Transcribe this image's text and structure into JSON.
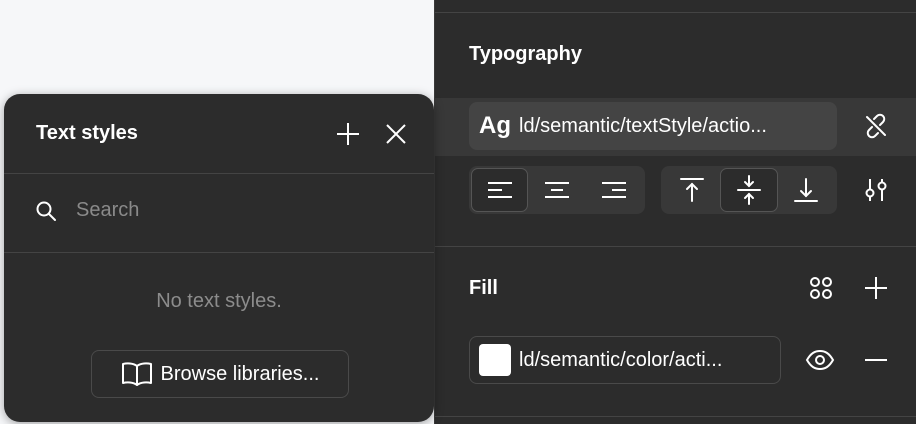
{
  "popup": {
    "title": "Text styles",
    "search_placeholder": "Search",
    "empty_message": "No text styles.",
    "browse_label": "Browse libraries..."
  },
  "typography": {
    "title": "Typography",
    "style_prefix": "Ag",
    "style_name": "ld/semantic/textStyle/actio...",
    "align_horizontal_selected": "left",
    "align_vertical_selected": "middle"
  },
  "fill": {
    "title": "Fill",
    "swatch_color": "#ffffff",
    "color_name": "ld/semantic/color/acti..."
  },
  "icons": {
    "popup": [
      "plus-icon",
      "close-icon",
      "search-icon",
      "book-icon"
    ],
    "typography": [
      "detach-style-icon",
      "align-left-icon",
      "align-center-icon",
      "align-right-icon",
      "align-top-icon",
      "align-middle-icon",
      "align-bottom-icon",
      "type-settings-icon"
    ],
    "fill": [
      "style-grid-icon",
      "plus-icon",
      "eye-icon",
      "minus-icon"
    ]
  }
}
